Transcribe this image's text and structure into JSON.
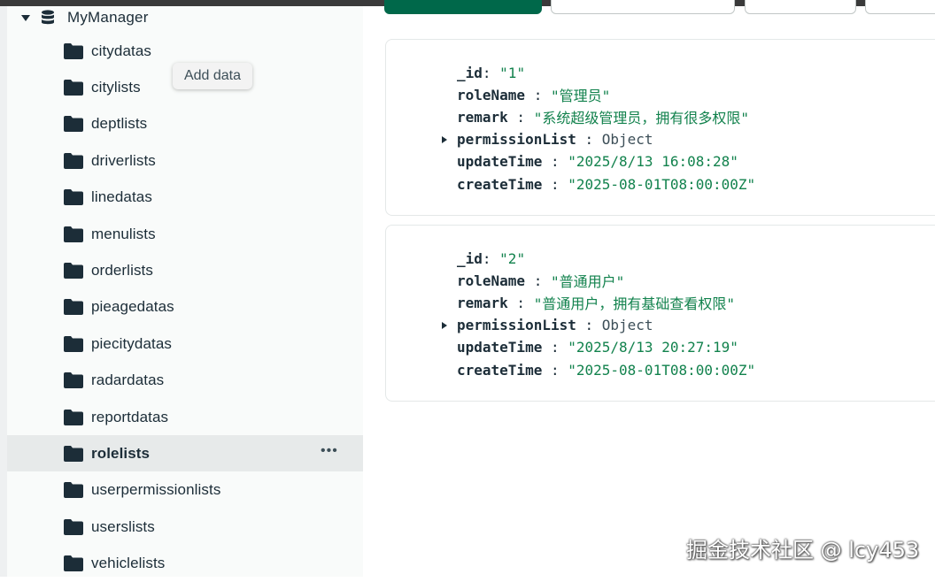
{
  "database": {
    "name": "MyManager",
    "caret": "caret-down",
    "icon": "database-icon"
  },
  "tooltip": "Add data",
  "collections": [
    {
      "name": "citydatas"
    },
    {
      "name": "citylists"
    },
    {
      "name": "deptlists"
    },
    {
      "name": "driverlists"
    },
    {
      "name": "linedatas"
    },
    {
      "name": "menulists"
    },
    {
      "name": "orderlists"
    },
    {
      "name": "pieagedatas"
    },
    {
      "name": "piecitydatas"
    },
    {
      "name": "radardatas"
    },
    {
      "name": "reportdatas"
    },
    {
      "name": "rolelists",
      "active": true
    },
    {
      "name": "userpermissionlists"
    },
    {
      "name": "userslists"
    },
    {
      "name": "vehiclelists"
    }
  ],
  "more_label": "•••",
  "documents": [
    {
      "fields": [
        {
          "key": "_id",
          "value": "\"1\""
        },
        {
          "key": "roleName",
          "value": "\"管理员\""
        },
        {
          "key": "remark",
          "value": "\"系统超级管理员，拥有很多权限\""
        },
        {
          "key": "permissionList",
          "value": "Object"
        },
        {
          "key": "updateTime",
          "value": "\"2025/8/13 16:08:28\""
        },
        {
          "key": "createTime",
          "value": "\"2025-08-01T08:00:00Z\""
        }
      ]
    },
    {
      "fields": [
        {
          "key": "_id",
          "value": "\"2\""
        },
        {
          "key": "roleName",
          "value": "\"普通用户\""
        },
        {
          "key": "remark",
          "value": "\"普通用户，拥有基础查看权限\""
        },
        {
          "key": "permissionList",
          "value": "Object"
        },
        {
          "key": "updateTime",
          "value": "\"2025/8/13 20:27:19\""
        },
        {
          "key": "createTime",
          "value": "\"2025-08-01T08:00:00Z\""
        }
      ]
    }
  ],
  "watermark": "掘金技术社区 @ lcy453",
  "colors": {
    "accent": "#00684a",
    "string": "#12824d",
    "text": "#1c2d38"
  }
}
